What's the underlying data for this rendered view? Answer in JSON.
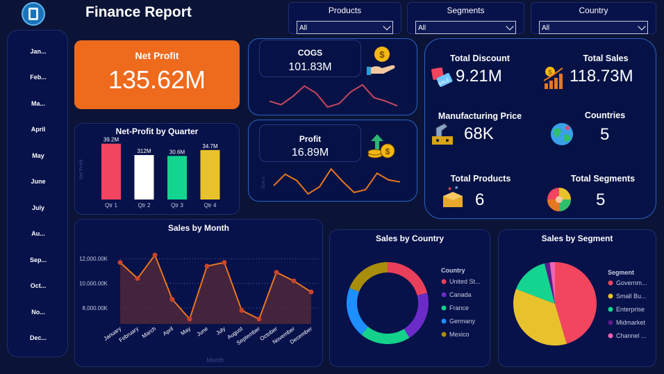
{
  "header": {
    "title": "Finance Report"
  },
  "filters": [
    {
      "label": "Products",
      "value": "All"
    },
    {
      "label": "Segments",
      "value": "All"
    },
    {
      "label": "Country",
      "value": "All"
    }
  ],
  "months_nav": [
    "Jan...",
    "Feb...",
    "Ma...",
    "April",
    "May",
    "June",
    "July",
    "Au...",
    "Sep...",
    "Oct...",
    "No...",
    "Dec..."
  ],
  "net_profit": {
    "label": "Net Profit",
    "value": "135.62M"
  },
  "cogs": {
    "label": "COGS",
    "value": "101.83M"
  },
  "profit": {
    "label": "Profit",
    "value": "16.89M",
    "axis_hint": "Sum o"
  },
  "kpis": {
    "total_discount": {
      "label": "Total Discount",
      "value": "9.21M"
    },
    "total_sales": {
      "label": "Total Sales",
      "value": "118.73M"
    },
    "manufacturing_price": {
      "label": "Manufacturing Price",
      "value": "68K"
    },
    "countries": {
      "label": "Countries",
      "value": "5"
    },
    "total_products": {
      "label": "Total Products",
      "value": "6"
    },
    "total_segments": {
      "label": "Total Segments",
      "value": "5"
    }
  },
  "colors": {
    "bg": "#0b1437",
    "card": "#07114a",
    "accent_orange": "#ee6a1d",
    "line_orange": "#e8771f",
    "line_red": "#c9475e"
  },
  "chart_data": [
    {
      "type": "bar",
      "title": "Net-Profit by Quarter",
      "ylabel": "Net Profit",
      "categories": [
        "Qtr 1",
        "Qtr 2",
        "Qtr 3",
        "Qtr 4"
      ],
      "values": [
        39.2,
        31.2,
        30.6,
        34.7
      ],
      "data_labels": [
        "39.2M",
        "312M",
        "30.6M",
        "34.7M"
      ],
      "colors": [
        "#f2455f",
        "#ffffff",
        "#14d590",
        "#e8c22c"
      ]
    },
    {
      "type": "area",
      "title": "Sales by Month",
      "xlabel": "Month",
      "categories": [
        "January",
        "February",
        "March",
        "April",
        "May",
        "June",
        "July",
        "August",
        "September",
        "October",
        "November",
        "December"
      ],
      "values": [
        11700,
        10400,
        12300,
        8700,
        7100,
        11400,
        11700,
        7800,
        7100,
        10900,
        10200,
        9300
      ],
      "yticks": [
        "12,000.00K",
        "10,000.00K",
        "8,000.00K"
      ],
      "ytick_values": [
        12000,
        10000,
        8000
      ],
      "ylim": [
        6700,
        13200
      ]
    },
    {
      "type": "pie",
      "title": "Sales by Country",
      "legend_title": "Country",
      "labels": [
        "United St...",
        "Canada",
        "France",
        "Germany",
        "Mexico"
      ],
      "values": [
        21,
        20,
        20,
        20,
        19
      ],
      "colors": [
        "#ea3f5a",
        "#6b2bc8",
        "#13d08a",
        "#1e8fff",
        "#a98d0c"
      ]
    },
    {
      "type": "pie",
      "title": "Sales by Segment",
      "legend_title": "Segment",
      "labels": [
        "Governm...",
        "Small Bu...",
        "Enterprise",
        "Midmarket",
        "Channel ..."
      ],
      "values": [
        45,
        35,
        15,
        2,
        2
      ],
      "colors": [
        "#f2455f",
        "#e8c22c",
        "#14d590",
        "#5d1a8a",
        "#f063b5"
      ]
    }
  ],
  "sparklines": {
    "cogs": [
      6.1,
      5.8,
      6.5,
      7.4,
      6.8,
      5.6,
      5.9,
      6.9,
      7.5,
      6.4,
      6.1,
      5.7
    ],
    "profit": [
      4.2,
      6.6,
      5.3,
      2.5,
      4.0,
      7.7,
      5.1,
      2.8,
      3.4,
      6.8,
      5.4,
      5.0
    ]
  }
}
